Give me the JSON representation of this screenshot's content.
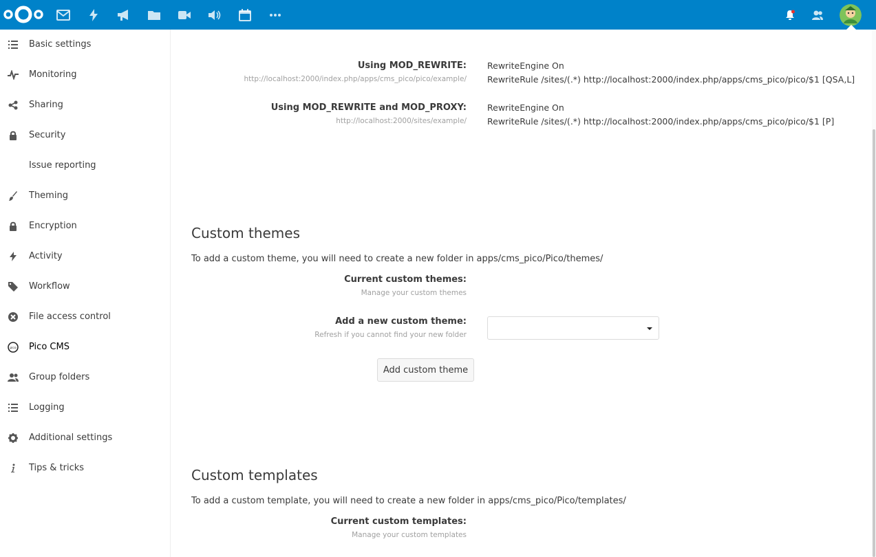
{
  "topbar": {
    "logo": "nextcloud-logo",
    "apps": [
      "mail-icon",
      "activity-icon",
      "announcements-icon",
      "files-icon",
      "talk-icon",
      "audio-icon",
      "calendar-icon",
      "more-apps-icon"
    ],
    "right": [
      "notifications-icon",
      "contacts-icon",
      "user-avatar"
    ],
    "color": "#0082c9"
  },
  "sidebar": {
    "items": [
      {
        "label": "Basic settings",
        "icon": "list-icon"
      },
      {
        "label": "Monitoring",
        "icon": "pulse-icon"
      },
      {
        "label": "Sharing",
        "icon": "share-icon"
      },
      {
        "label": "Security",
        "icon": "lock-icon"
      },
      {
        "label": "Issue reporting",
        "icon": ""
      },
      {
        "label": "Theming",
        "icon": "brush-icon"
      },
      {
        "label": "Encryption",
        "icon": "lock-icon"
      },
      {
        "label": "Activity",
        "icon": "lightning-icon"
      },
      {
        "label": "Workflow",
        "icon": "tag-icon"
      },
      {
        "label": "File access control",
        "icon": "block-icon"
      },
      {
        "label": "Pico CMS",
        "icon": "pico-icon",
        "active": true
      },
      {
        "label": "Group folders",
        "icon": "group-icon"
      },
      {
        "label": "Logging",
        "icon": "list-icon"
      },
      {
        "label": "Additional settings",
        "icon": "gear-icon"
      },
      {
        "label": "Tips & tricks",
        "icon": "info-icon"
      }
    ]
  },
  "rewrite": {
    "mod_rewrite_label": "Using MOD_REWRITE:",
    "mod_rewrite_url": "http://localhost:2000/index.php/apps/cms_pico/pico/example/",
    "mod_rewrite_line1": "RewriteEngine On",
    "mod_rewrite_line2": "RewriteRule /sites/(.*) http://localhost:2000/index.php/apps/cms_pico/pico/$1 [QSA,L]",
    "mod_proxy_label": "Using MOD_REWRITE and MOD_PROXY:",
    "mod_proxy_url": "http://localhost:2000/sites/example/",
    "mod_proxy_line1": "RewriteEngine On",
    "mod_proxy_line2": "RewriteRule /sites/(.*) http://localhost:2000/index.php/apps/cms_pico/pico/$1 [P]"
  },
  "themes": {
    "heading": "Custom themes",
    "intro": "To add a custom theme, you will need to create a new folder in apps/cms_pico/Pico/themes/",
    "current_label": "Current custom themes:",
    "current_sub": "Manage your custom themes",
    "add_label": "Add a new custom theme:",
    "add_sub": "Refresh if you cannot find your new folder",
    "select_value": "",
    "add_button": "Add custom theme"
  },
  "templates": {
    "heading": "Custom templates",
    "intro": "To add a custom template, you will need to create a new folder in apps/cms_pico/Pico/templates/",
    "current_label": "Current custom templates:",
    "current_sub": "Manage your custom templates"
  }
}
